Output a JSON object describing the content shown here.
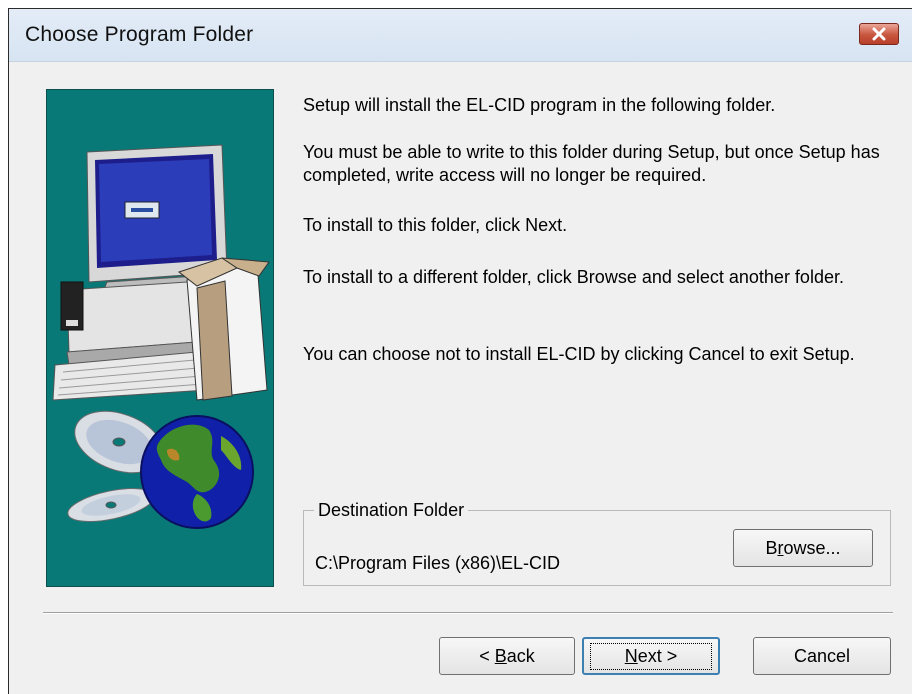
{
  "window": {
    "title": "Choose Program Folder",
    "close_label": "Close"
  },
  "content": {
    "paragraphs": [
      "Setup will install the EL-CID program in the following folder.",
      "You must be able to write to this folder during Setup, but once Setup has completed, write access will no longer be required.",
      "To install to this folder, click Next.",
      "To install to a different folder, click Browse and select another folder.",
      "You can choose not to install EL-CID by clicking Cancel to exit Setup."
    ]
  },
  "destination": {
    "group_label": "Destination Folder",
    "path": "C:\\Program Files (x86)\\EL-CID",
    "browse_label": "Browse...",
    "browse_accel": "r"
  },
  "buttons": {
    "back_prefix": "< ",
    "back_accel": "B",
    "back_rest": "ack",
    "next_accel": "N",
    "next_rest": "ext >",
    "cancel": "Cancel"
  },
  "colors": {
    "art_background": "#097978",
    "close_button": "#c8553e",
    "title_bar": "#dce7f3",
    "dialog_background": "#f0f0f0"
  }
}
